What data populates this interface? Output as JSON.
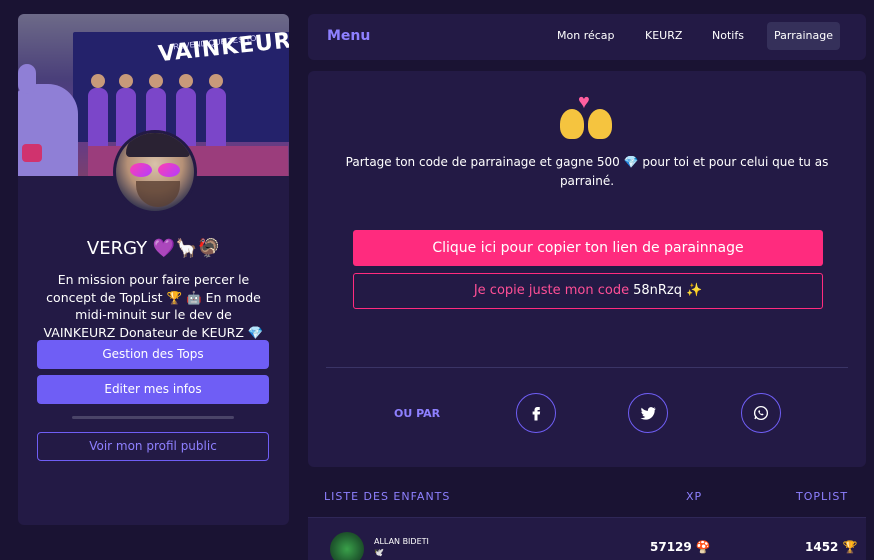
{
  "profile": {
    "username": "VERGY 💜🦙🦃",
    "bio": "En mission pour faire percer le concept de TopList 🏆 🤖 En mode midi-minuit sur le dev de VAINKEURZ Donateur de KEURZ 💎",
    "cover_banner_text": "VAINKEURZ.C",
    "cover_banner_small": "REVENDIQUE TES TO",
    "buttons": {
      "manage_tops": "Gestion des Tops",
      "edit_info": "Editer mes infos",
      "public_profile": "Voir mon profil public"
    }
  },
  "nav": {
    "title": "Menu",
    "items": [
      "Mon récap",
      "KEURZ",
      "Notifs",
      "Parrainage"
    ],
    "active": "Parrainage"
  },
  "referral": {
    "emoji": "💏",
    "share_text": "Partage ton code de parrainage et gagne 500 💎 pour toi et pour celui que tu as parrainé.",
    "copy_link_label": "Clique ici pour copier ton lien de parainnage",
    "copy_code_prefix": "Je copie juste mon code",
    "code": "58nRzq",
    "sparkle": "✨",
    "or_label": "OU PAR",
    "socials": [
      "facebook-icon",
      "twitter-icon",
      "whatsapp-icon"
    ]
  },
  "children": {
    "headers": {
      "list": "LISTE DES ENFANTS",
      "xp": "XP",
      "toplist": "TOPLIST"
    },
    "rows": [
      {
        "name": "ALLAN BIDETI",
        "flag": "🕊️",
        "xp": "57129 🍄",
        "toplist": "1452 🏆"
      }
    ]
  },
  "colors": {
    "background": "#1a1333",
    "card": "#231a45",
    "accent_purple": "#6f5ef5",
    "accent_pink": "#ff2b7e",
    "label_purple": "#8e80ff"
  }
}
